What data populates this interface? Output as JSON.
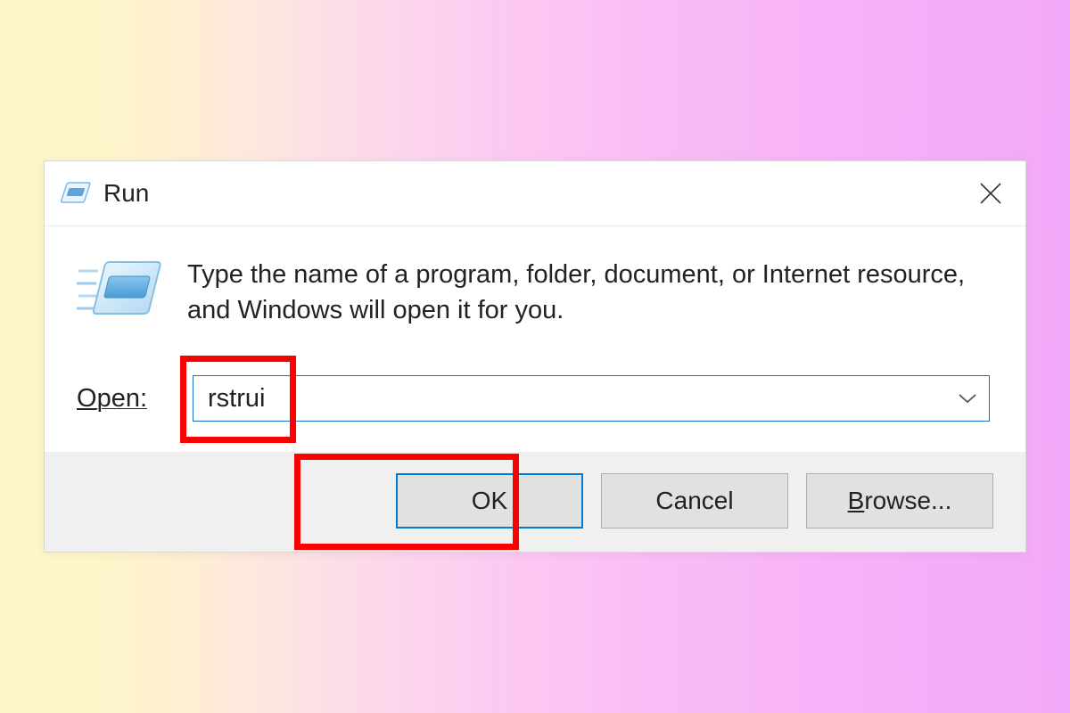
{
  "dialog": {
    "title": "Run",
    "description": "Type the name of a program, folder, document, or Internet resource, and Windows will open it for you.",
    "open_label": "Open:",
    "open_accelerator": "O",
    "open_rest": "pen:",
    "input_value": "rstrui",
    "buttons": {
      "ok": "OK",
      "cancel": "Cancel",
      "browse": "Browse...",
      "browse_accelerator": "B",
      "browse_rest": "rowse..."
    }
  }
}
